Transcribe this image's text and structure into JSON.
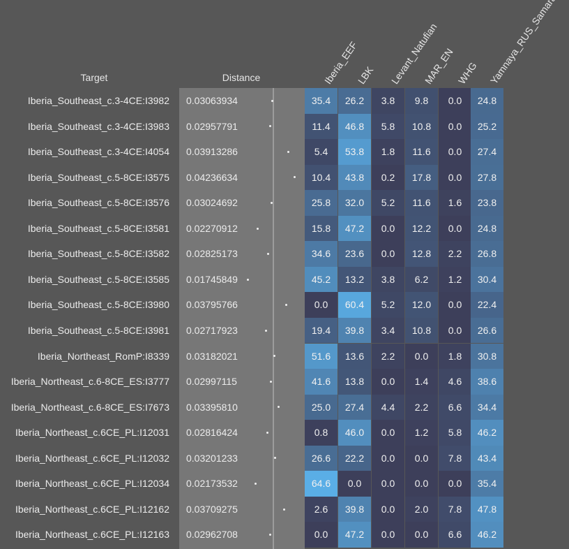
{
  "headers": {
    "target": "Target",
    "distance": "Distance"
  },
  "chart_data": {
    "type": "heatmap",
    "columns": [
      "Iberia_EEF",
      "LBK",
      "Levant_Natufian",
      "MAR_EN",
      "WHG",
      "Yamnaya_RUS_Samara"
    ],
    "colors": {
      "low": "#3d3f5a",
      "high": "#5aaee6"
    },
    "rows": [
      {
        "target": "Iberia_Southeast_c.3-4CE:I3982",
        "distance": "0.03063934",
        "values": [
          "35.4",
          "26.2",
          "3.8",
          "9.8",
          "0.0",
          "24.8"
        ]
      },
      {
        "target": "Iberia_Southeast_c.3-4CE:I3983",
        "distance": "0.02957791",
        "values": [
          "11.4",
          "46.8",
          "5.8",
          "10.8",
          "0.0",
          "25.2"
        ]
      },
      {
        "target": "Iberia_Southeast_c.3-4CE:I4054",
        "distance": "0.03913286",
        "values": [
          "5.4",
          "53.8",
          "1.8",
          "11.6",
          "0.0",
          "27.4"
        ]
      },
      {
        "target": "Iberia_Southeast_c.5-8CE:I3575",
        "distance": "0.04236634",
        "values": [
          "10.4",
          "43.8",
          "0.2",
          "17.8",
          "0.0",
          "27.8"
        ]
      },
      {
        "target": "Iberia_Southeast_c.5-8CE:I3576",
        "distance": "0.03024692",
        "values": [
          "25.8",
          "32.0",
          "5.2",
          "11.6",
          "1.6",
          "23.8"
        ]
      },
      {
        "target": "Iberia_Southeast_c.5-8CE:I3581",
        "distance": "0.02270912",
        "values": [
          "15.8",
          "47.2",
          "0.0",
          "12.2",
          "0.0",
          "24.8"
        ]
      },
      {
        "target": "Iberia_Southeast_c.5-8CE:I3582",
        "distance": "0.02825173",
        "values": [
          "34.6",
          "23.6",
          "0.0",
          "12.8",
          "2.2",
          "26.8"
        ]
      },
      {
        "target": "Iberia_Southeast_c.5-8CE:I3585",
        "distance": "0.01745849",
        "values": [
          "45.2",
          "13.2",
          "3.8",
          "6.2",
          "1.2",
          "30.4"
        ]
      },
      {
        "target": "Iberia_Southeast_c.5-8CE:I3980",
        "distance": "0.03795766",
        "values": [
          "0.0",
          "60.4",
          "5.2",
          "12.0",
          "0.0",
          "22.4"
        ]
      },
      {
        "target": "Iberia_Southeast_c.5-8CE:I3981",
        "distance": "0.02717923",
        "values": [
          "19.4",
          "39.8",
          "3.4",
          "10.8",
          "0.0",
          "26.6"
        ]
      },
      {
        "target": "Iberia_Northeast_RomP:I8339",
        "distance": "0.03182021",
        "values": [
          "51.6",
          "13.6",
          "2.2",
          "0.0",
          "1.8",
          "30.8"
        ]
      },
      {
        "target": "Iberia_Northeast_c.6-8CE_ES:I3777",
        "distance": "0.02997115",
        "values": [
          "41.6",
          "13.8",
          "0.0",
          "1.4",
          "4.6",
          "38.6"
        ]
      },
      {
        "target": "Iberia_Northeast_c.6-8CE_ES:I7673",
        "distance": "0.03395810",
        "values": [
          "25.0",
          "27.4",
          "4.4",
          "2.2",
          "6.6",
          "34.4"
        ]
      },
      {
        "target": "Iberia_Northeast_c.6CE_PL:I12031",
        "distance": "0.02816424",
        "values": [
          "0.8",
          "46.0",
          "0.0",
          "1.2",
          "5.8",
          "46.2"
        ]
      },
      {
        "target": "Iberia_Northeast_c.6CE_PL:I12032",
        "distance": "0.03201233",
        "values": [
          "26.6",
          "22.2",
          "0.0",
          "0.0",
          "7.8",
          "43.4"
        ]
      },
      {
        "target": "Iberia_Northeast_c.6CE_PL:I12034",
        "distance": "0.02173532",
        "values": [
          "64.6",
          "0.0",
          "0.0",
          "0.0",
          "0.0",
          "35.4"
        ]
      },
      {
        "target": "Iberia_Northeast_c.6CE_PL:I12162",
        "distance": "0.03709275",
        "values": [
          "2.6",
          "39.8",
          "0.0",
          "2.0",
          "7.8",
          "47.8"
        ]
      },
      {
        "target": "Iberia_Northeast_c.6CE_PL:I12163",
        "distance": "0.02962708",
        "values": [
          "0.0",
          "47.2",
          "0.0",
          "0.0",
          "6.6",
          "46.2"
        ]
      }
    ]
  }
}
